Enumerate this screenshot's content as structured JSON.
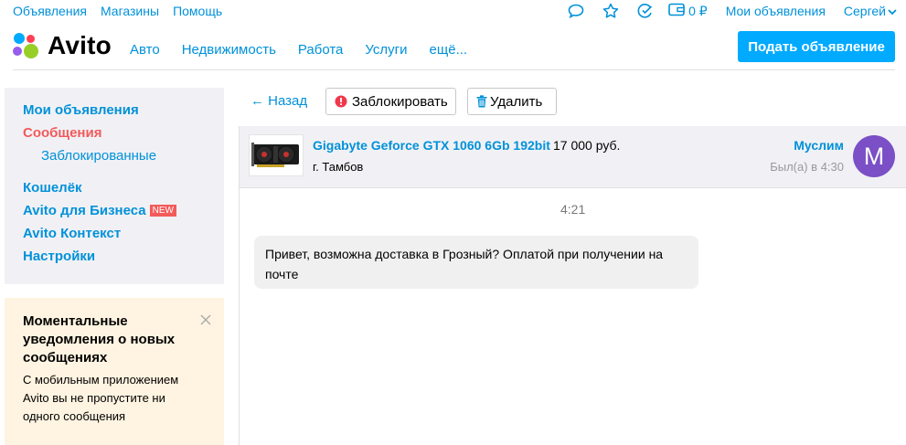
{
  "topbar": {
    "links": [
      "Объявления",
      "Магазины",
      "Помощь"
    ],
    "wallet_amount": "0 ₽",
    "my_ads": "Мои объявления",
    "user_name": "Сергей",
    "icons": [
      "chat-icon",
      "star-icon",
      "search-check-icon",
      "wallet-icon"
    ]
  },
  "header": {
    "logo_text": "Avito",
    "nav": [
      "Авто",
      "Недвижимость",
      "Работа",
      "Услуги",
      "ещё..."
    ],
    "post_button": "Подать объявление",
    "colors": {
      "accent": "#00aaff",
      "link": "#0091d9"
    }
  },
  "sidebar": {
    "items": [
      {
        "label": "Мои объявления"
      },
      {
        "label": "Сообщения",
        "active": true
      },
      {
        "label": "Заблокированные",
        "sub": true
      },
      {
        "label": "Кошелёк"
      },
      {
        "label": "Avito для Бизнеса",
        "badge": "NEW"
      },
      {
        "label": "Avito Контекст"
      },
      {
        "label": "Настройки"
      }
    ]
  },
  "notification": {
    "title": "Моментальные уведомления о новых сообщениях",
    "body": "С мобильным приложением Avito вы не пропустите ни одного сообщения"
  },
  "actions": {
    "back": "← Назад",
    "block": "Заблокировать",
    "delete": "Удалить"
  },
  "listing": {
    "title": "Gigabyte Geforce GTX 1060 6Gb 192bit",
    "price": "17 000 руб.",
    "city": "г. Тамбов",
    "seller": "Муслим",
    "last_seen": "Был(а) в 4:30",
    "avatar_letter": "M",
    "avatar_color": "#7b4fc6"
  },
  "chat": {
    "time": "4:21",
    "message": "Привет, возможна доставка в Грозный? Оплатой при получении на почте"
  }
}
